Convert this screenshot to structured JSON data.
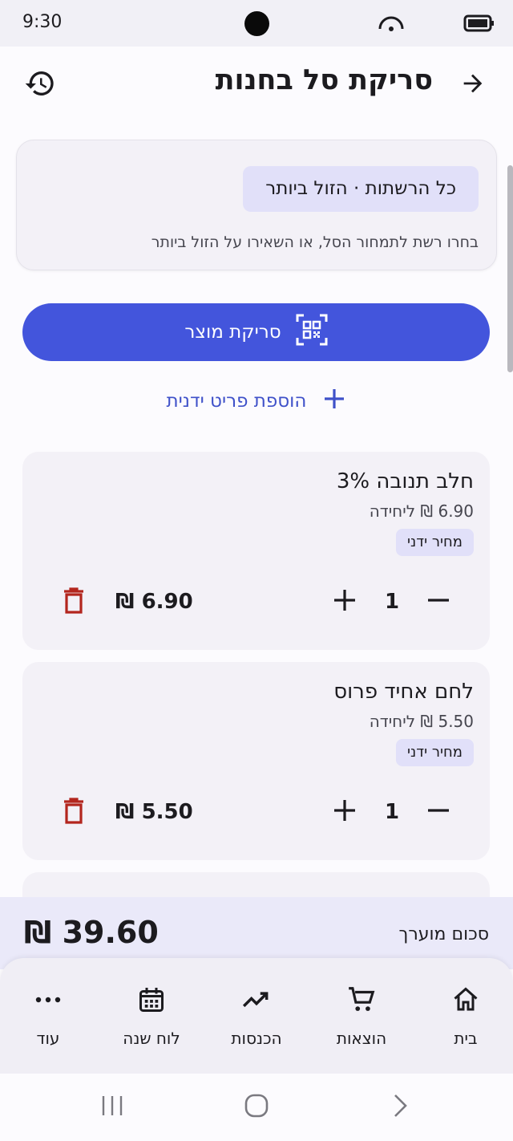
{
  "status_bar": {
    "time": "9:30"
  },
  "app_bar": {
    "title": "סריקת סל בחנות",
    "back_icon": "arrow-right-icon",
    "history_icon": "history-icon"
  },
  "store_selector": {
    "chip_label": "כל הרשתות · הזול ביותר",
    "hint": "בחרו רשת לתמחור הסל, או השאירו על הזול ביותר"
  },
  "actions": {
    "scan_label": "סריקת מוצר",
    "add_manual_label": "הוספת פריט ידנית"
  },
  "items": [
    {
      "name": "חלב תנובה 3%",
      "unit_price": "6.90 ₪ ליחידה",
      "badge": "מחיר ידני",
      "quantity": "1",
      "total": "6.90 ₪"
    },
    {
      "name": "לחם אחיד פרוס",
      "unit_price": "5.50 ₪ ליחידה",
      "badge": "מחיר ידני",
      "quantity": "1",
      "total": "5.50 ₪"
    }
  ],
  "summary": {
    "label": "סכום מוערך",
    "amount": "39.60 ₪"
  },
  "bottom_nav": [
    {
      "label": "בית",
      "icon": "home-icon"
    },
    {
      "label": "הוצאות",
      "icon": "cart-icon"
    },
    {
      "label": "הכנסות",
      "icon": "trending-up-icon"
    },
    {
      "label": "לוח שנה",
      "icon": "calendar-icon"
    },
    {
      "label": "עוד",
      "icon": "more-horizontal-icon"
    }
  ],
  "colors": {
    "primary": "#4355dc",
    "chip": "#e1e0f9",
    "card": "#f3f1f7",
    "delete": "#b3261e"
  }
}
